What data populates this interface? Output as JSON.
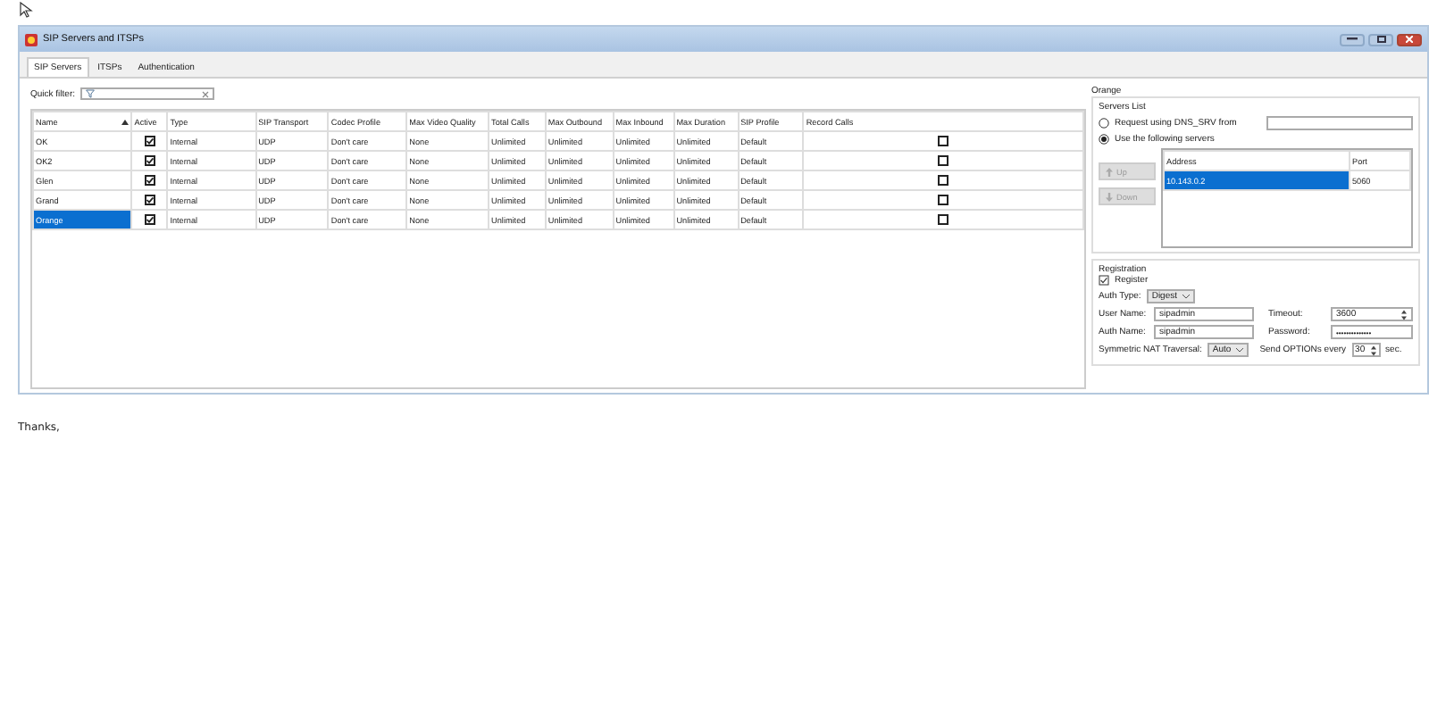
{
  "window": {
    "title": "SIP Servers and ITSPs"
  },
  "tabs": [
    {
      "label": "SIP Servers",
      "selected": true
    },
    {
      "label": "ITSPs",
      "selected": false
    },
    {
      "label": "Authentication",
      "selected": false
    }
  ],
  "quick_filter": {
    "label": "Quick filter:"
  },
  "table": {
    "columns": [
      {
        "label": "Name",
        "sorted": true
      },
      {
        "label": "Active",
        "sorted": false
      },
      {
        "label": "Type",
        "sorted": false
      },
      {
        "label": "SIP Transport",
        "sorted": false
      },
      {
        "label": "Codec Profile",
        "sorted": false
      },
      {
        "label": "Max Video Quality",
        "sorted": false
      },
      {
        "label": "Total Calls",
        "sorted": false
      },
      {
        "label": "Max Outbound",
        "sorted": false
      },
      {
        "label": "Max Inbound",
        "sorted": false
      },
      {
        "label": "Max Duration",
        "sorted": false
      },
      {
        "label": "SIP Profile",
        "sorted": false
      },
      {
        "label": "Record Calls",
        "sorted": false
      }
    ],
    "rows": [
      {
        "name": "OK",
        "active": true,
        "type": "Internal",
        "sip_transport": "UDP",
        "codec_profile": "Don't care",
        "max_video_quality": "None",
        "total_calls": "Unlimited",
        "max_outbound": "Unlimited",
        "max_inbound": "Unlimited",
        "max_duration": "Unlimited",
        "sip_profile": "Default",
        "record_calls": false,
        "selected": false
      },
      {
        "name": "OK2",
        "active": true,
        "type": "Internal",
        "sip_transport": "UDP",
        "codec_profile": "Don't care",
        "max_video_quality": "None",
        "total_calls": "Unlimited",
        "max_outbound": "Unlimited",
        "max_inbound": "Unlimited",
        "max_duration": "Unlimited",
        "sip_profile": "Default",
        "record_calls": false,
        "selected": false
      },
      {
        "name": "Glen",
        "active": true,
        "type": "Internal",
        "sip_transport": "UDP",
        "codec_profile": "Don't care",
        "max_video_quality": "None",
        "total_calls": "Unlimited",
        "max_outbound": "Unlimited",
        "max_inbound": "Unlimited",
        "max_duration": "Unlimited",
        "sip_profile": "Default",
        "record_calls": false,
        "selected": false
      },
      {
        "name": "Grand",
        "active": true,
        "type": "Internal",
        "sip_transport": "UDP",
        "codec_profile": "Don't care",
        "max_video_quality": "None",
        "total_calls": "Unlimited",
        "max_outbound": "Unlimited",
        "max_inbound": "Unlimited",
        "max_duration": "Unlimited",
        "sip_profile": "Default",
        "record_calls": false,
        "selected": false
      },
      {
        "name": "Orange",
        "active": true,
        "type": "Internal",
        "sip_transport": "UDP",
        "codec_profile": "Don't care",
        "max_video_quality": "None",
        "total_calls": "Unlimited",
        "max_outbound": "Unlimited",
        "max_inbound": "Unlimited",
        "max_duration": "Unlimited",
        "sip_profile": "Default",
        "record_calls": false,
        "selected": true
      }
    ]
  },
  "details": {
    "title": "Orange",
    "servers_list": {
      "label": "Servers List",
      "options": [
        {
          "label": "Request using DNS_SRV from",
          "selected": false
        },
        {
          "label": "Use the following servers",
          "selected": true
        }
      ],
      "up_button": {
        "label": "Up",
        "disabled": true
      },
      "down_button": {
        "label": "Down",
        "disabled": true
      },
      "columns": [
        "Address",
        "Port"
      ],
      "rows": [
        {
          "address": "10.143.0.2",
          "port": "5060",
          "selected": true
        }
      ]
    },
    "registration": {
      "label": "Registration",
      "register": {
        "label": "Register",
        "checked": true
      },
      "auth_type": {
        "label": "Auth Type:",
        "value": "Digest"
      },
      "user_name": {
        "label": "User Name:",
        "value": "sipadmin"
      },
      "timeout": {
        "label": "Timeout:",
        "value": "3600"
      },
      "auth_name": {
        "label": "Auth Name:",
        "value": "sipadmin"
      },
      "password": {
        "label": "Password:",
        "value": "••••••••••••••"
      },
      "symmetric_nat": {
        "label": "Symmetric NAT Traversal:",
        "value": "Auto"
      },
      "send_options": {
        "label": "Send OPTIONs every",
        "value": "30",
        "unit": "sec."
      }
    }
  },
  "footer_text": "Thanks,"
}
